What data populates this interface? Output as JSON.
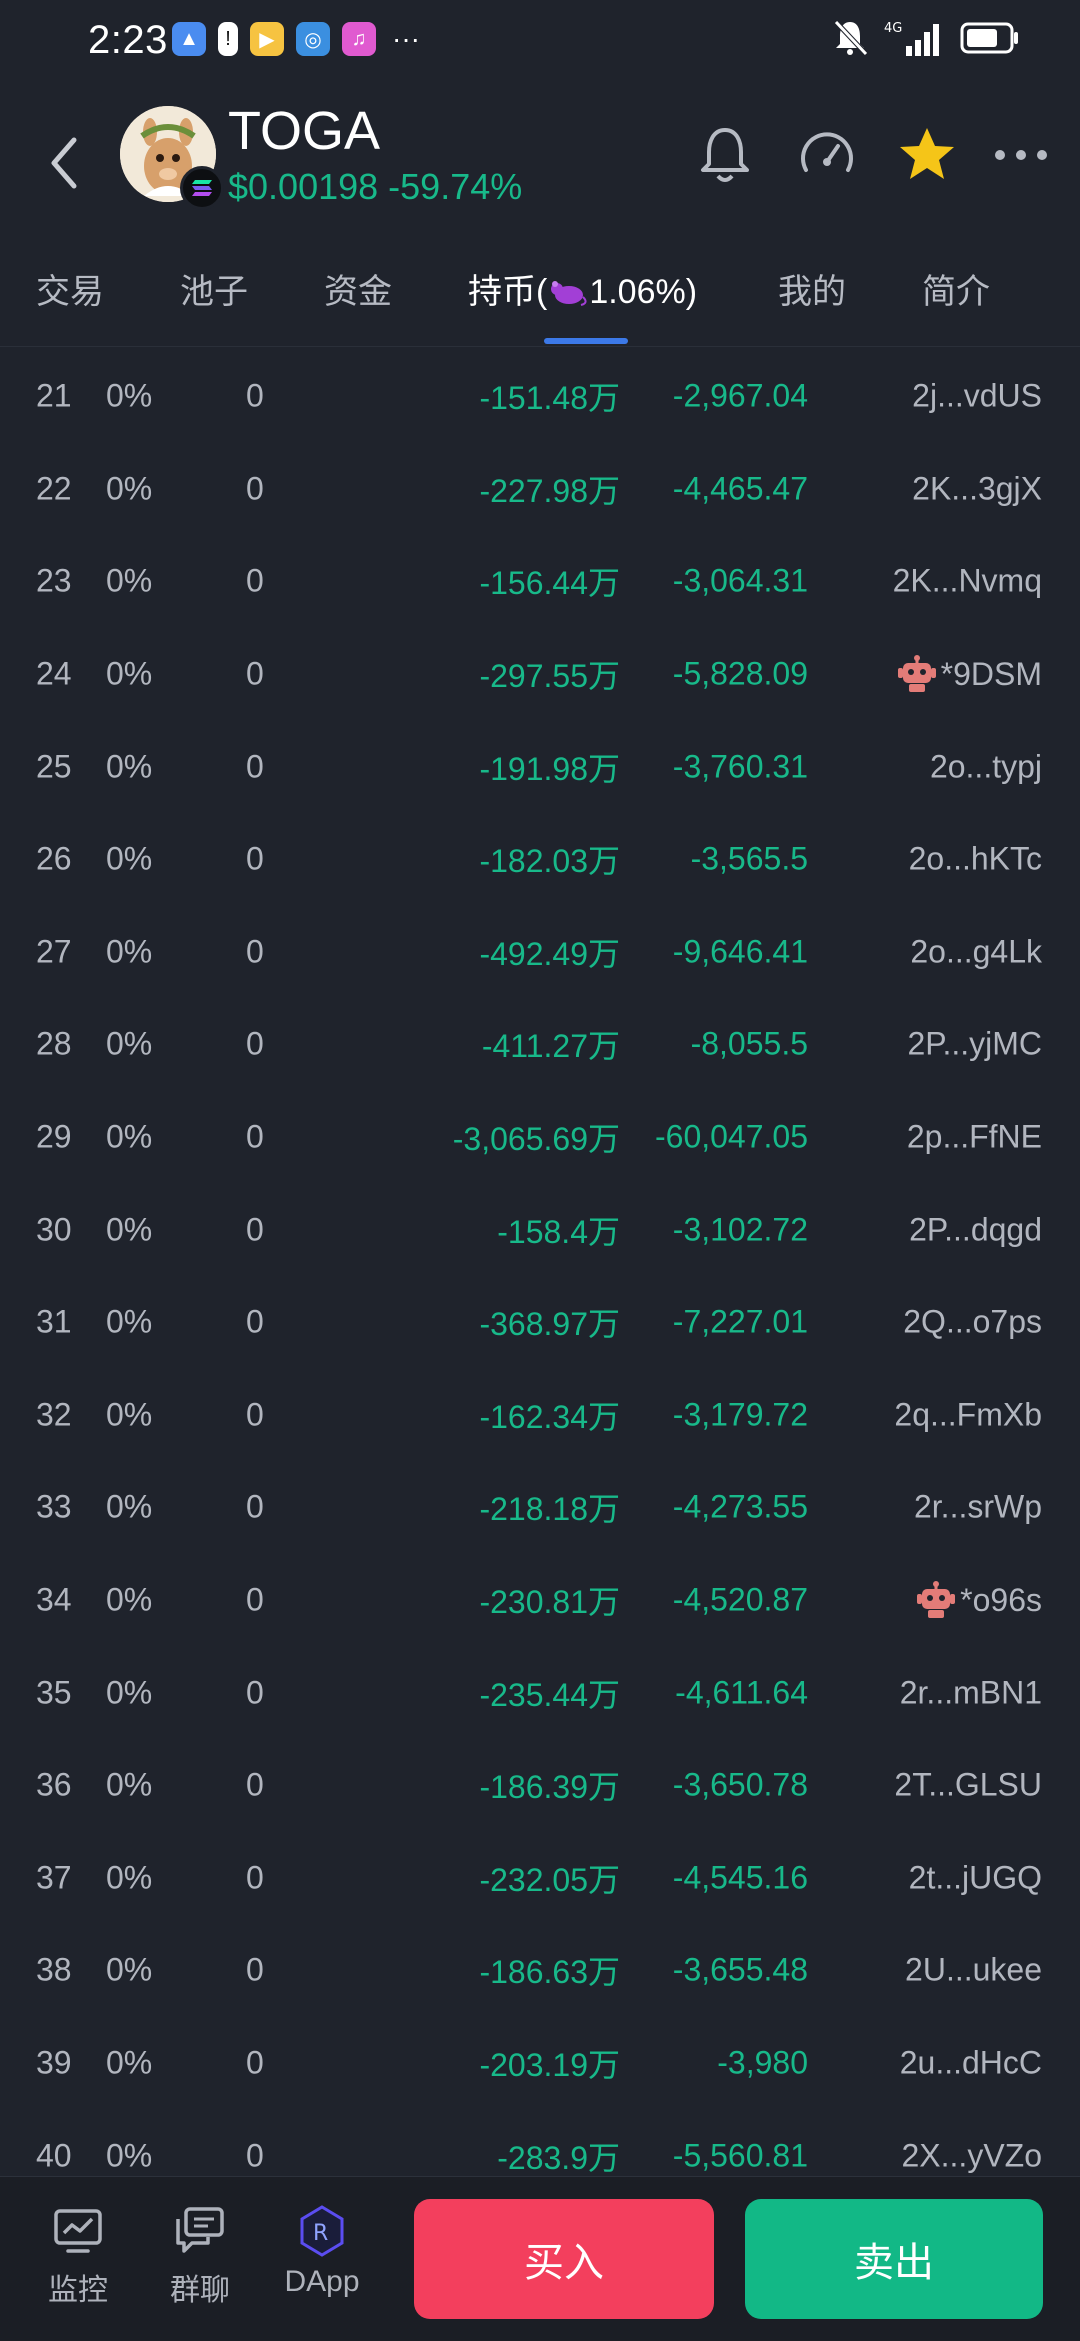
{
  "status": {
    "time": "2:23",
    "dots": "···"
  },
  "header": {
    "token_name": "TOGA",
    "price": "$0.00198",
    "change": "-59.74%"
  },
  "tabs": [
    {
      "label": "交易"
    },
    {
      "label": "池子"
    },
    {
      "label": "资金"
    },
    {
      "label": "持币(",
      "suffix": "1.06%)",
      "active": true
    },
    {
      "label": "我的"
    },
    {
      "label": "简介"
    }
  ],
  "rows": [
    {
      "rank": "21",
      "pct": "0%",
      "zero": "0",
      "amount": "-151.48万",
      "usd": "-2,967.04",
      "addr": "2j...vdUS",
      "bot": false
    },
    {
      "rank": "22",
      "pct": "0%",
      "zero": "0",
      "amount": "-227.98万",
      "usd": "-4,465.47",
      "addr": "2K...3gjX",
      "bot": false
    },
    {
      "rank": "23",
      "pct": "0%",
      "zero": "0",
      "amount": "-156.44万",
      "usd": "-3,064.31",
      "addr": "2K...Nvmq",
      "bot": false
    },
    {
      "rank": "24",
      "pct": "0%",
      "zero": "0",
      "amount": "-297.55万",
      "usd": "-5,828.09",
      "addr": "*9DSM",
      "bot": true
    },
    {
      "rank": "25",
      "pct": "0%",
      "zero": "0",
      "amount": "-191.98万",
      "usd": "-3,760.31",
      "addr": "2o...typj",
      "bot": false
    },
    {
      "rank": "26",
      "pct": "0%",
      "zero": "0",
      "amount": "-182.03万",
      "usd": "-3,565.5",
      "addr": "2o...hKTc",
      "bot": false
    },
    {
      "rank": "27",
      "pct": "0%",
      "zero": "0",
      "amount": "-492.49万",
      "usd": "-9,646.41",
      "addr": "2o...g4Lk",
      "bot": false
    },
    {
      "rank": "28",
      "pct": "0%",
      "zero": "0",
      "amount": "-411.27万",
      "usd": "-8,055.5",
      "addr": "2P...yjMC",
      "bot": false
    },
    {
      "rank": "29",
      "pct": "0%",
      "zero": "0",
      "amount": "-3,065.69万",
      "usd": "-60,047.05",
      "addr": "2p...FfNE",
      "bot": false
    },
    {
      "rank": "30",
      "pct": "0%",
      "zero": "0",
      "amount": "-158.4万",
      "usd": "-3,102.72",
      "addr": "2P...dqgd",
      "bot": false
    },
    {
      "rank": "31",
      "pct": "0%",
      "zero": "0",
      "amount": "-368.97万",
      "usd": "-7,227.01",
      "addr": "2Q...o7ps",
      "bot": false
    },
    {
      "rank": "32",
      "pct": "0%",
      "zero": "0",
      "amount": "-162.34万",
      "usd": "-3,179.72",
      "addr": "2q...FmXb",
      "bot": false
    },
    {
      "rank": "33",
      "pct": "0%",
      "zero": "0",
      "amount": "-218.18万",
      "usd": "-4,273.55",
      "addr": "2r...srWp",
      "bot": false
    },
    {
      "rank": "34",
      "pct": "0%",
      "zero": "0",
      "amount": "-230.81万",
      "usd": "-4,520.87",
      "addr": "*o96s",
      "bot": true
    },
    {
      "rank": "35",
      "pct": "0%",
      "zero": "0",
      "amount": "-235.44万",
      "usd": "-4,611.64",
      "addr": "2r...mBN1",
      "bot": false
    },
    {
      "rank": "36",
      "pct": "0%",
      "zero": "0",
      "amount": "-186.39万",
      "usd": "-3,650.78",
      "addr": "2T...GLSU",
      "bot": false
    },
    {
      "rank": "37",
      "pct": "0%",
      "zero": "0",
      "amount": "-232.05万",
      "usd": "-4,545.16",
      "addr": "2t...jUGQ",
      "bot": false
    },
    {
      "rank": "38",
      "pct": "0%",
      "zero": "0",
      "amount": "-186.63万",
      "usd": "-3,655.48",
      "addr": "2U...ukee",
      "bot": false
    },
    {
      "rank": "39",
      "pct": "0%",
      "zero": "0",
      "amount": "-203.19万",
      "usd": "-3,980",
      "addr": "2u...dHcC",
      "bot": false
    },
    {
      "rank": "40",
      "pct": "0%",
      "zero": "0",
      "amount": "-283.9万",
      "usd": "-5,560.81",
      "addr": "2X...yVZo",
      "bot": false
    }
  ],
  "bottom_nav": {
    "monitor": "监控",
    "group_chat": "群聊",
    "dapp": "DApp",
    "buy": "买入",
    "sell": "卖出"
  },
  "colors": {
    "background": "#1f232c",
    "positive": "#18b98a",
    "buy": "#f33f5d",
    "sell": "#12b886",
    "accent": "#3c79e8",
    "star": "#f5c518"
  }
}
